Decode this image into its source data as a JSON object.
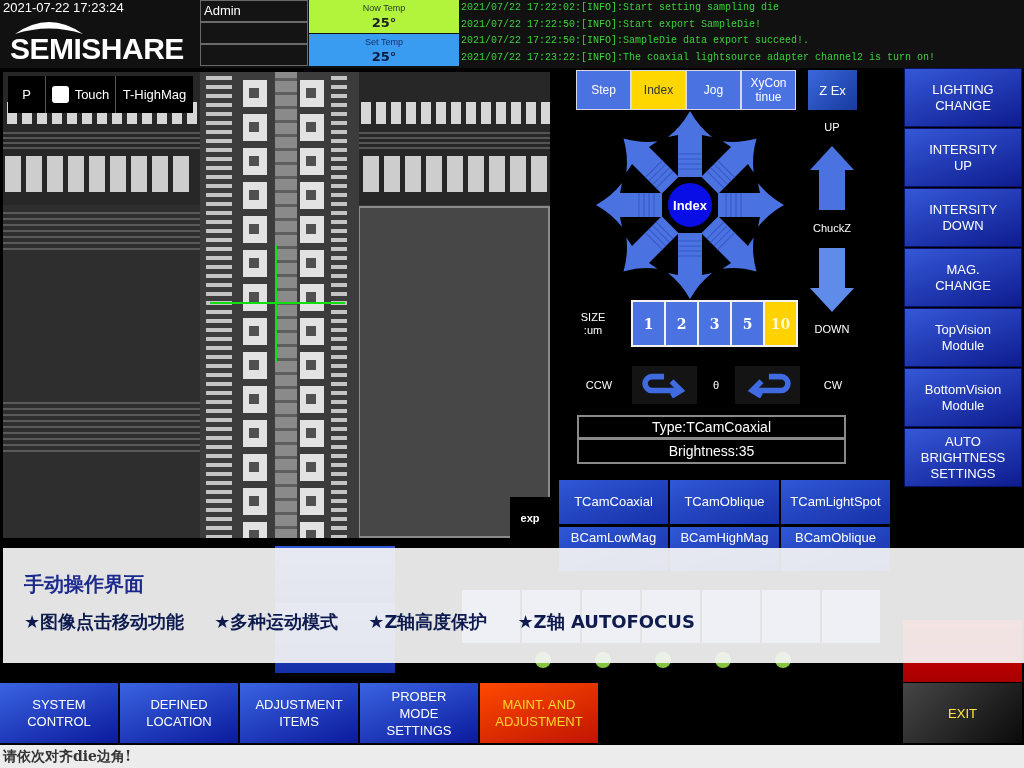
{
  "header": {
    "datetime": "2021-07-22 17:23:24",
    "logo": "SEMISHARE",
    "user": "Admin"
  },
  "temperatures": [
    {
      "kind": "now",
      "label": "Now Temp",
      "value": "25°"
    },
    {
      "kind": "set",
      "label": "Set Temp",
      "value": "25°"
    }
  ],
  "log": [
    "2021/07/22 17:22:02:[INFO]:Start setting sampling die",
    "2021/07/22 17:22:50:[INFO]:Start export SampleDie!",
    "2021/07/22 17:22:50:[INFO]:SampleDie data export succeed!.",
    "2021/07/22 17:23:22:[INFO]:The coaxial lightsource adapter channel2 is turn on!"
  ],
  "camera": {
    "p_button": "P",
    "touch": {
      "label": "Touch",
      "checked": false
    },
    "magnification_button": "T-HighMag",
    "exp_button": "exp"
  },
  "motion": {
    "modes": [
      {
        "label": "Step",
        "selected": false
      },
      {
        "label": "Index",
        "selected": true
      },
      {
        "label": "Jog",
        "selected": false
      },
      {
        "label": "XyContinue",
        "selected": false
      }
    ],
    "z_ex_button": "Z Ex",
    "center_button": "Index",
    "z_up_label": "UP",
    "z_axis_label": "ChuckZ",
    "z_down_label": "DOWN",
    "size_label": "SIZE :um",
    "sizes": [
      {
        "label": "1",
        "selected": false
      },
      {
        "label": "2",
        "selected": false
      },
      {
        "label": "3",
        "selected": false
      },
      {
        "label": "5",
        "selected": false
      },
      {
        "label": "10",
        "selected": true
      }
    ],
    "ccw_label": "CCW",
    "theta_label": "θ",
    "cw_label": "CW",
    "light_type": "Type:TCamCoaxial",
    "brightness": "Brightness:35"
  },
  "light_sources": [
    "TCamCoaxial",
    "TCamOblique",
    "TCamLightSpot",
    "BCamLowMag",
    "BCamHighMag",
    "BCamOblique"
  ],
  "side_buttons": [
    "LIGHTING CHANGE",
    "INTERSITY UP",
    "INTERSITY DOWN",
    "MAG. CHANGE",
    "TopVision Module",
    "BottomVision Module",
    "AUTO BRIGHTNESS SETTINGS"
  ],
  "lamp_buttons": [
    {
      "lamp": false
    },
    {
      "lamp": true
    },
    {
      "lamp": true
    },
    {
      "lamp": true
    },
    {
      "lamp": true
    },
    {
      "lamp": true
    },
    {
      "lamp": false
    }
  ],
  "exit_button": "EXIT",
  "nav": [
    {
      "label": "SYSTEM CONTROL",
      "kind": "normal"
    },
    {
      "label": "DEFINED LOCATION",
      "kind": "normal"
    },
    {
      "label": "ADJUSTMENT ITEMS",
      "kind": "normal"
    },
    {
      "label": "PROBER MODE SETTINGS",
      "kind": "normal"
    },
    {
      "label": "MAINT. AND ADJUSTMENT",
      "kind": "warning"
    }
  ],
  "banner": {
    "title": "手动操作界面",
    "features": [
      "★图像点击移动功能",
      "★多种运动模式",
      "★Z轴高度保护",
      "★Z轴 AUTOFOCUS"
    ]
  },
  "status_bar": "请依次对齐die边角!"
}
